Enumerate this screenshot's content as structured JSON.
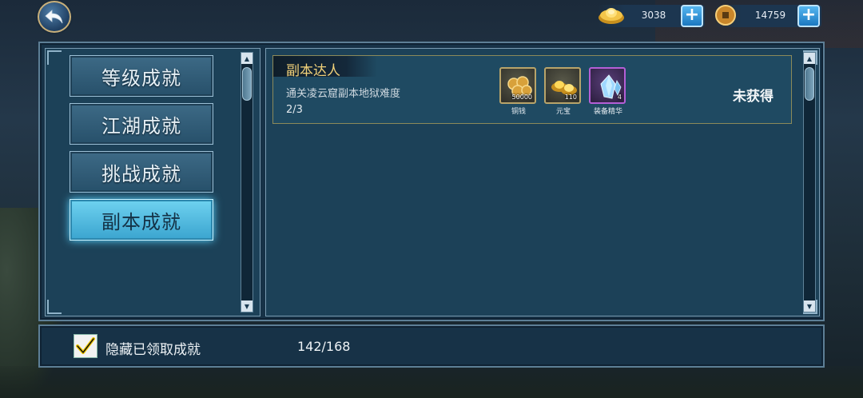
{
  "currencies": [
    {
      "name": "yuanbao-icon",
      "value": "3038"
    },
    {
      "name": "coin-icon",
      "value": "14759"
    }
  ],
  "categories": [
    {
      "label": "等级成就",
      "active": false
    },
    {
      "label": "江湖成就",
      "active": false
    },
    {
      "label": "挑战成就",
      "active": false
    },
    {
      "label": "副本成就",
      "active": true
    }
  ],
  "achievement": {
    "title": "副本达人",
    "description": "通关凌云窟副本地狱难度",
    "progress": "2/3",
    "status": "未获得",
    "rewards": [
      {
        "name": "铜钱",
        "qty": "50000",
        "icon": "copper-coins-icon"
      },
      {
        "name": "元宝",
        "qty": "110",
        "icon": "gold-ingot-icon"
      },
      {
        "name": "装备精华",
        "qty": "4",
        "icon": "crystal-icon"
      }
    ]
  },
  "footer": {
    "hide_claimed_label": "隐藏已领取成就",
    "hide_claimed_checked": true,
    "count": "142/168"
  }
}
